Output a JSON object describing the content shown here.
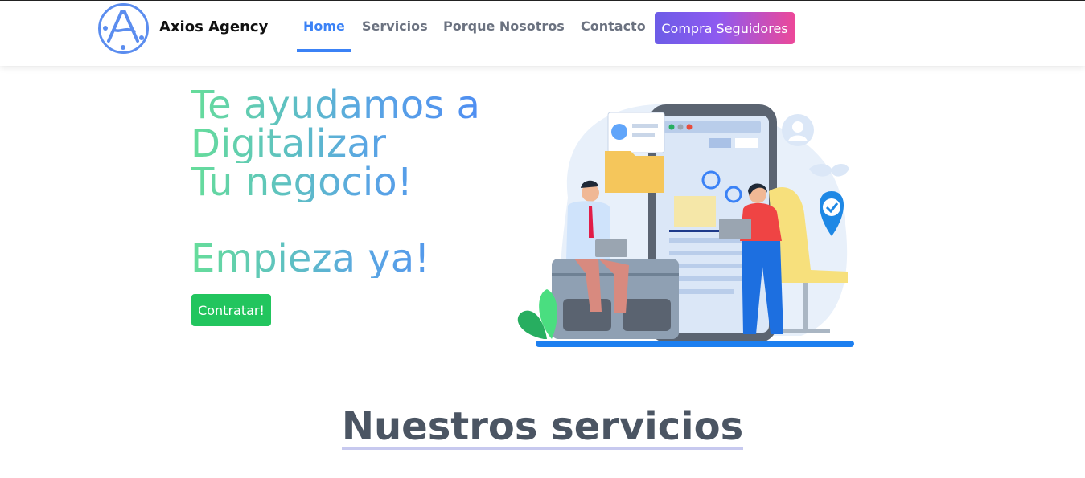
{
  "header": {
    "brand": "Axios Agency",
    "logo_icon": "axios-logo-icon",
    "nav": [
      {
        "label": "Home",
        "active": true
      },
      {
        "label": "Servicios",
        "active": false
      },
      {
        "label": "Porque Nosotros",
        "active": false
      },
      {
        "label": "Contacto",
        "active": false
      }
    ],
    "cta_label": "Compra Seguidores"
  },
  "hero": {
    "lines": [
      "Te ayudamos a",
      "Digitalizar",
      "Tu negocio!",
      "Empieza ya!"
    ],
    "button_label": "Contratar!",
    "illustration_icon": "business-meeting-illustration"
  },
  "services": {
    "title": "Nuestros servicios"
  },
  "colors": {
    "accent_blue": "#3b82f6",
    "cta_gradient_start": "#6c5ce7",
    "cta_gradient_end": "#ec4899",
    "green_button": "#22c55e",
    "hero_gradient_start": "#66dd9a",
    "hero_gradient_end": "#4f8ef2"
  }
}
